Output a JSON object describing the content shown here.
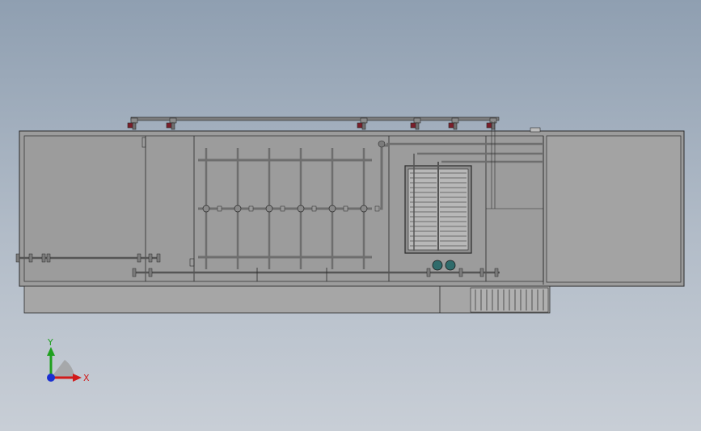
{
  "viewport": {
    "background_top": "#8f9fb1",
    "background_bottom": "#c8ced6"
  },
  "model": {
    "body_fill": "#9a9a9a",
    "panel_fill": "#a5a5a5",
    "line_color": "#2a2a2a",
    "pipe_color": "#7b7b7b",
    "valve_color": "#7a1e2a",
    "pump_color": "#2f6b6b",
    "media_color": "#b8b8b8"
  },
  "triad": {
    "x_label": "X",
    "y_label": "Y",
    "x_color": "#d11a1a",
    "y_color": "#1fa01f",
    "z_color": "#1a2fd1"
  }
}
